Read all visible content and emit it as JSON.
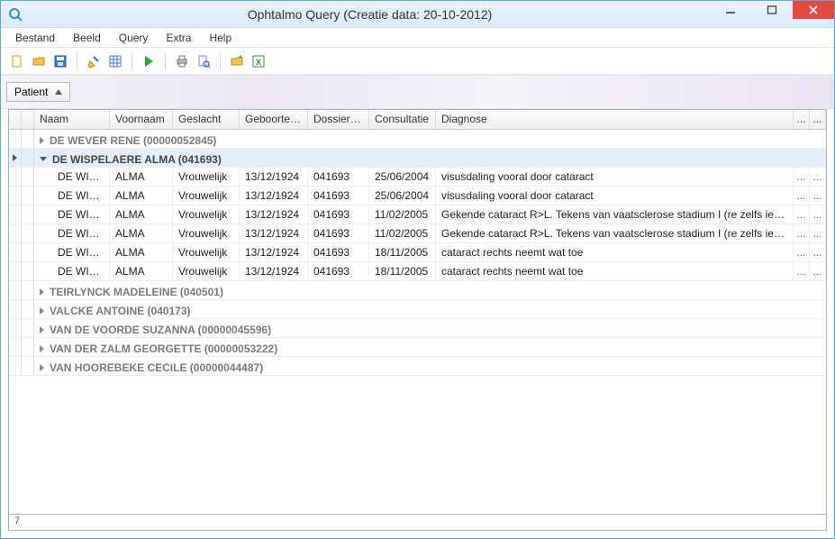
{
  "window": {
    "title": "Ophtalmo Query (Creatie data: 20-10-2012)"
  },
  "menubar": {
    "items": [
      "Bestand",
      "Beeld",
      "Query",
      "Extra",
      "Help"
    ]
  },
  "groupby": {
    "label": "Patient"
  },
  "columns": {
    "naam": "Naam",
    "voornaam": "Voornaam",
    "geslacht": "Geslacht",
    "geboorte": "Geboorted...",
    "dossier": "Dossiernu...",
    "consult": "Consultatie",
    "diagnose": "Diagnose",
    "dots": "..."
  },
  "groups": [
    {
      "label": "DE WEVER RENE (00000052845)",
      "expanded": false,
      "selected": false,
      "rows": []
    },
    {
      "label": "DE WISPELAERE ALMA (041693)",
      "expanded": true,
      "selected": true,
      "rows": [
        {
          "naam": "DE WISP...",
          "voornaam": "ALMA",
          "geslacht": "Vrouwelijk",
          "geboorte": "13/12/1924",
          "dossier": "041693",
          "consult": "25/06/2004",
          "diagnose": "visusdaling vooral door cataract"
        },
        {
          "naam": "DE WISP...",
          "voornaam": "ALMA",
          "geslacht": "Vrouwelijk",
          "geboorte": "13/12/1924",
          "dossier": "041693",
          "consult": "25/06/2004",
          "diagnose": "visusdaling vooral door cataract"
        },
        {
          "naam": "DE WISP...",
          "voornaam": "ALMA",
          "geslacht": "Vrouwelijk",
          "geboorte": "13/12/1924",
          "dossier": "041693",
          "consult": "11/02/2005",
          "diagnose": "Gekende cataract R>L.  Tekens van vaatsclerose stadium I (re zelfs iets meer: I ..."
        },
        {
          "naam": "DE WISP...",
          "voornaam": "ALMA",
          "geslacht": "Vrouwelijk",
          "geboorte": "13/12/1924",
          "dossier": "041693",
          "consult": "11/02/2005",
          "diagnose": "Gekende cataract R>L.  Tekens van vaatsclerose stadium I (re zelfs iets meer: I ..."
        },
        {
          "naam": "DE WISP...",
          "voornaam": "ALMA",
          "geslacht": "Vrouwelijk",
          "geboorte": "13/12/1924",
          "dossier": "041693",
          "consult": "18/11/2005",
          "diagnose": "cataract rechts neemt wat toe"
        },
        {
          "naam": "DE WISP...",
          "voornaam": "ALMA",
          "geslacht": "Vrouwelijk",
          "geboorte": "13/12/1924",
          "dossier": "041693",
          "consult": "18/11/2005",
          "diagnose": "cataract rechts neemt wat toe"
        }
      ]
    },
    {
      "label": "TEIRLYNCK MADELEINE (040501)",
      "expanded": false,
      "selected": false,
      "rows": []
    },
    {
      "label": "VALCKE ANTOINE (040173)",
      "expanded": false,
      "selected": false,
      "rows": []
    },
    {
      "label": "VAN DE VOORDE SUZANNA (00000045596)",
      "expanded": false,
      "selected": false,
      "rows": []
    },
    {
      "label": "VAN DER ZALM GEORGETTE (00000053222)",
      "expanded": false,
      "selected": false,
      "rows": []
    },
    {
      "label": "VAN HOOREBEKE CECILE (00000044487)",
      "expanded": false,
      "selected": false,
      "rows": []
    }
  ],
  "status": {
    "text": "7"
  }
}
